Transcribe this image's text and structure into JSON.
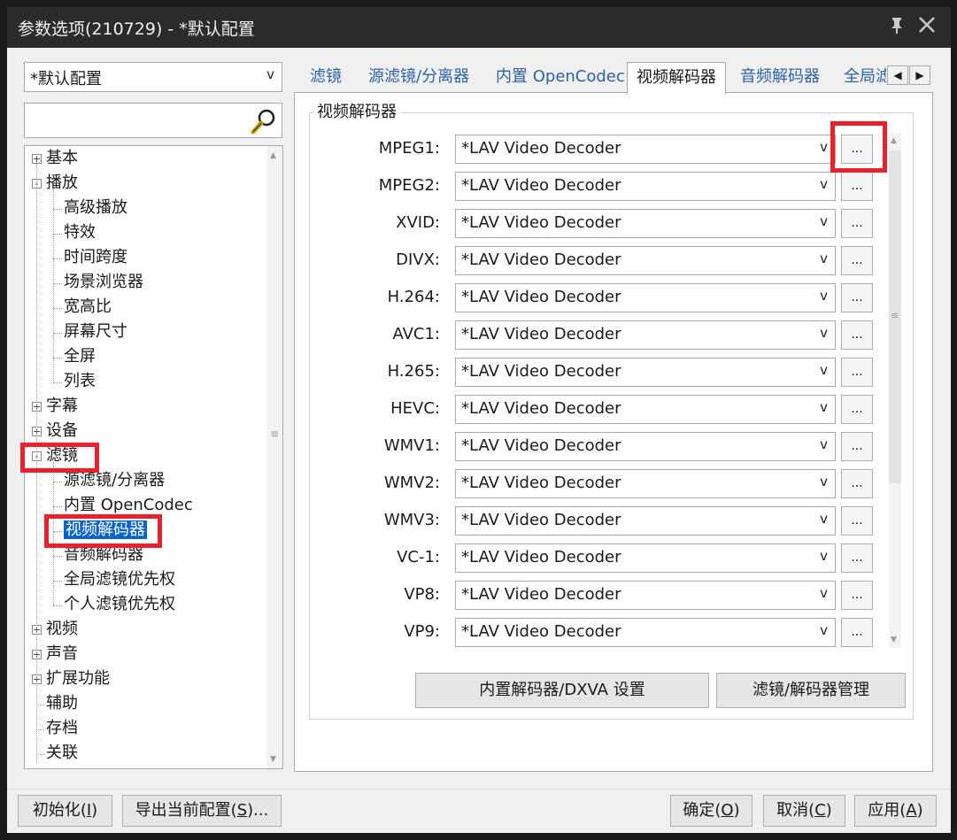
{
  "window": {
    "title": "参数选项(210729) - *默认配置",
    "pin_icon": "pin-icon",
    "close_icon": "close-icon"
  },
  "profile_combo": {
    "value": "*默认配置",
    "arrow": "v"
  },
  "search": {
    "value": "",
    "icon": "magnifier-icon"
  },
  "tree": [
    {
      "label": "基本",
      "expander": "+",
      "level": 0
    },
    {
      "label": "播放",
      "expander": "-",
      "level": 0
    },
    {
      "label": "高级播放",
      "level": 1
    },
    {
      "label": "特效",
      "level": 1
    },
    {
      "label": "时间跨度",
      "level": 1
    },
    {
      "label": "场景浏览器",
      "level": 1
    },
    {
      "label": "宽高比",
      "level": 1
    },
    {
      "label": "屏幕尺寸",
      "level": 1
    },
    {
      "label": "全屏",
      "level": 1
    },
    {
      "label": "列表",
      "level": 1
    },
    {
      "label": "字幕",
      "expander": "+",
      "level": 0
    },
    {
      "label": "设备",
      "expander": "+",
      "level": 0
    },
    {
      "label": "滤镜",
      "expander": "-",
      "level": 0
    },
    {
      "label": "源滤镜/分离器",
      "level": 1
    },
    {
      "label": "内置 OpenCodec",
      "level": 1
    },
    {
      "label": "视频解码器",
      "level": 1,
      "selected": true
    },
    {
      "label": "音频解码器",
      "level": 1
    },
    {
      "label": "全局滤镜优先权",
      "level": 1
    },
    {
      "label": "个人滤镜优先权",
      "level": 1
    },
    {
      "label": "视频",
      "expander": "+",
      "level": 0
    },
    {
      "label": "声音",
      "expander": "+",
      "level": 0
    },
    {
      "label": "扩展功能",
      "expander": "+",
      "level": 0
    },
    {
      "label": "辅助",
      "level": 0
    },
    {
      "label": "存档",
      "level": 0
    },
    {
      "label": "关联",
      "level": 0
    }
  ],
  "tabs": [
    "滤镜",
    "源滤镜/分离器",
    "内置 OpenCodec",
    "视频解码器",
    "音频解码器",
    "全局滤"
  ],
  "tab_scroll": {
    "left": "◀",
    "right": "▶"
  },
  "group_title": "视频解码器",
  "decoders": [
    {
      "label": "MPEG1:",
      "value": "*LAV Video Decoder"
    },
    {
      "label": "MPEG2:",
      "value": "*LAV Video Decoder"
    },
    {
      "label": "XVID:",
      "value": "*LAV Video Decoder"
    },
    {
      "label": "DIVX:",
      "value": "*LAV Video Decoder"
    },
    {
      "label": "H.264:",
      "value": "*LAV Video Decoder"
    },
    {
      "label": "AVC1:",
      "value": "*LAV Video Decoder"
    },
    {
      "label": "H.265:",
      "value": "*LAV Video Decoder"
    },
    {
      "label": "HEVC:",
      "value": "*LAV Video Decoder"
    },
    {
      "label": "WMV1:",
      "value": "*LAV Video Decoder"
    },
    {
      "label": "WMV2:",
      "value": "*LAV Video Decoder"
    },
    {
      "label": "WMV3:",
      "value": "*LAV Video Decoder"
    },
    {
      "label": "VC-1:",
      "value": "*LAV Video Decoder"
    },
    {
      "label": "VP8:",
      "value": "*LAV Video Decoder"
    },
    {
      "label": "VP9:",
      "value": "*LAV Video Decoder"
    }
  ],
  "dropdown_arrow": "v",
  "dots_label": "...",
  "buttons": {
    "dxva": "内置解码器/DXVA 设置",
    "filter_manager": "滤镜/解码器管理",
    "init": "初始化",
    "init_key": "I",
    "export": "导出当前配置",
    "export_key": "S",
    "export_suffix": "...",
    "ok": "确定",
    "ok_key": "O",
    "cancel": "取消",
    "cancel_key": "C",
    "apply": "应用",
    "apply_key": "A"
  },
  "colors": {
    "highlight": "#e8212e",
    "selection": "#0a64c8",
    "titlebar": "#2b2b2b"
  }
}
